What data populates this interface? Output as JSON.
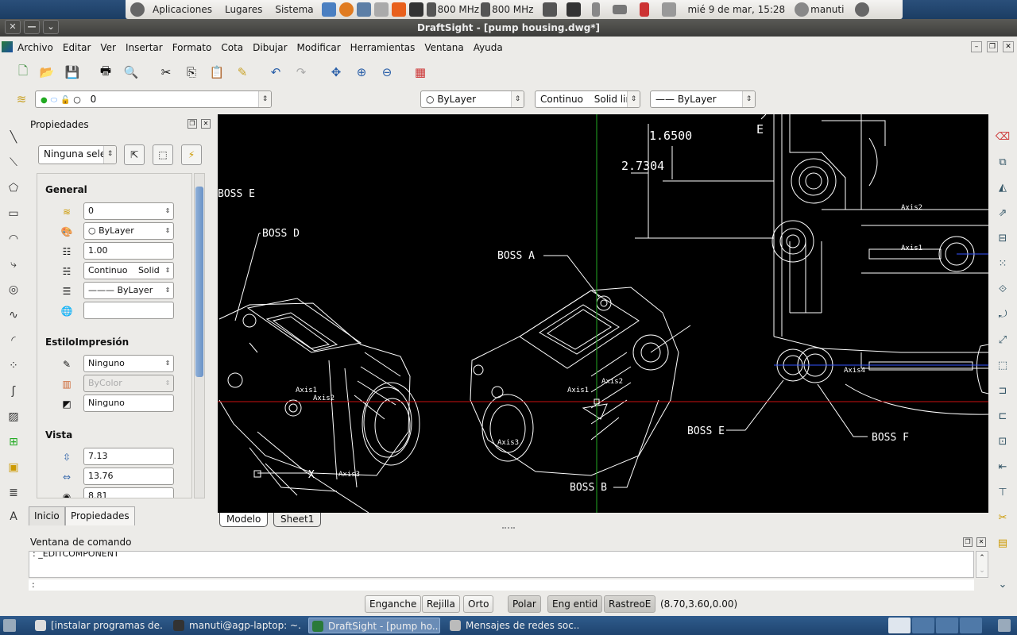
{
  "top_panel": {
    "applications": "Aplicaciones",
    "places": "Lugares",
    "system": "Sistema",
    "cpu1": "800 MHz",
    "cpu2": "800 MHz",
    "clock": "mié  9 de mar, 15:28",
    "user": "manuti"
  },
  "window": {
    "title": "DraftSight - [pump housing.dwg*]",
    "close": "✕",
    "minimize": "—",
    "menu": "⌄"
  },
  "menu": [
    "Archivo",
    "Editar",
    "Ver",
    "Insertar",
    "Formato",
    "Cota",
    "Dibujar",
    "Modificar",
    "Herramientas",
    "Ventana",
    "Ayuda"
  ],
  "layer_toolbar": {
    "layer_value": "0",
    "color_value": "ByLayer",
    "linetype_value": "Continuo",
    "linetype_desc": "Solid lir",
    "lineweight_value": "ByLayer"
  },
  "properties": {
    "title": "Propiedades",
    "selection": "Ninguna selec",
    "general_header": "General",
    "layer": "0",
    "color": "ByLayer",
    "scale": "1.00",
    "linetype": "Continuo",
    "linetype_desc": "Solid",
    "lineweight": "ByLayer",
    "hyperlink": "",
    "print_header": "EstiloImpresión",
    "print_style": "Ninguno",
    "print_color": "ByColor",
    "print_table": "Ninguno",
    "view_header": "Vista",
    "view_height": "7.13",
    "view_width": "13.76",
    "view_z": "8.81",
    "tab_start": "Inicio",
    "tab_props": "Propiedades"
  },
  "drawing": {
    "boss_e_left": "BOSS E",
    "boss_d": "BOSS D",
    "boss_a": "BOSS A",
    "boss_b": "BOSS B",
    "boss_e_right": "BOSS E",
    "boss_f": "BOSS F",
    "dim1": "1.6500",
    "dim2": "2.7304",
    "axis1": "Axis1",
    "axis2": "Axis2",
    "axis3": "Axis3",
    "axis4": "Axis4",
    "label_e": "E",
    "label_x": "X"
  },
  "sheet_tabs": {
    "model": "Modelo",
    "sheet1": "Sheet1"
  },
  "command": {
    "title": "Ventana de comando",
    "history": ": _EDITCOMPONENT",
    "prompt": ":"
  },
  "status": {
    "snap": "Enganche",
    "grid": "Rejilla",
    "ortho": "Orto",
    "polar": "Polar",
    "esnap": "Eng entid",
    "etrack": "RastreoE",
    "coords": "(8.70,3.60,0.00)"
  },
  "taskbar": {
    "t1": "[instalar programas de...",
    "t2": "manuti@agp-laptop: ~...",
    "t3": "DraftSight - [pump ho...",
    "t4": "Mensajes de redes soc..."
  },
  "colors": {
    "canvas": "#000000",
    "crosshair_v": "#22aa22",
    "crosshair_h": "#cc1111"
  }
}
